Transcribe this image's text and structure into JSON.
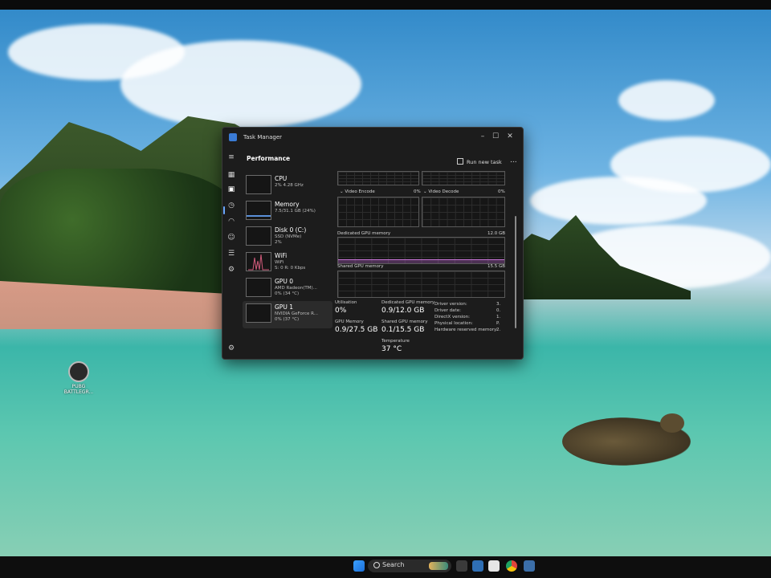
{
  "desktop": {
    "icons": [
      {
        "label": "PUBG BATTLEGR..."
      }
    ]
  },
  "taskbar": {
    "search_label": "Search",
    "apps": [
      "start-icon",
      "search",
      "widgets-icon",
      "file-explorer-icon",
      "mail-icon",
      "calendar-icon",
      "chrome-icon",
      "task-manager-icon"
    ]
  },
  "task_manager": {
    "title": "Task Manager",
    "section": "Performance",
    "run_new_task": "Run new task",
    "more": "...",
    "nav_icons": [
      "hamburger-icon",
      "processes-icon",
      "performance-icon",
      "app-history-icon",
      "startup-apps-icon",
      "users-icon",
      "details-icon",
      "services-icon",
      "settings-icon"
    ],
    "perf_items": [
      {
        "name": "CPU",
        "sub1": "2% 4.28 GHz",
        "sub2": ""
      },
      {
        "name": "Memory",
        "sub1": "7.5/31.1 GB (24%)",
        "sub2": ""
      },
      {
        "name": "Disk 0 (C:)",
        "sub1": "SSD (NVMe)",
        "sub2": "2%"
      },
      {
        "name": "WiFi",
        "sub1": "WiFi",
        "sub2": "S: 0 R: 0 Kbps"
      },
      {
        "name": "GPU 0",
        "sub1": "AMD Radeon(TM)...",
        "sub2": "0% (34 °C)"
      },
      {
        "name": "GPU 1",
        "sub1": "NVIDIA GeForce R...",
        "sub2": "0% (37 °C)"
      }
    ],
    "graphs": {
      "video_encode_label": "Video Encode",
      "video_encode_value": "0%",
      "video_decode_label": "Video Decode",
      "video_decode_value": "0%",
      "dedicated_label": "Dedicated GPU memory",
      "dedicated_max": "12.0 GB",
      "shared_label": "Shared GPU memory",
      "shared_max": "15.5 GB"
    },
    "stats": {
      "utilisation_label": "Utilisation",
      "utilisation_value": "0%",
      "dedicated_label": "Dedicated GPU memory",
      "dedicated_value": "0.9/12.0 GB",
      "gpu_memory_label": "GPU Memory",
      "gpu_memory_value": "0.9/27.5 GB",
      "shared_label": "Shared GPU memory",
      "shared_value": "0.1/15.5 GB",
      "temperature_label": "Temperature",
      "temperature_value": "37 °C"
    },
    "details": [
      {
        "label": "Driver version:",
        "value": "3."
      },
      {
        "label": "Driver date:",
        "value": "0."
      },
      {
        "label": "DirectX version:",
        "value": "1."
      },
      {
        "label": "Physical location:",
        "value": "P."
      },
      {
        "label": "Hardware reserved memory:",
        "value": "2."
      }
    ]
  }
}
